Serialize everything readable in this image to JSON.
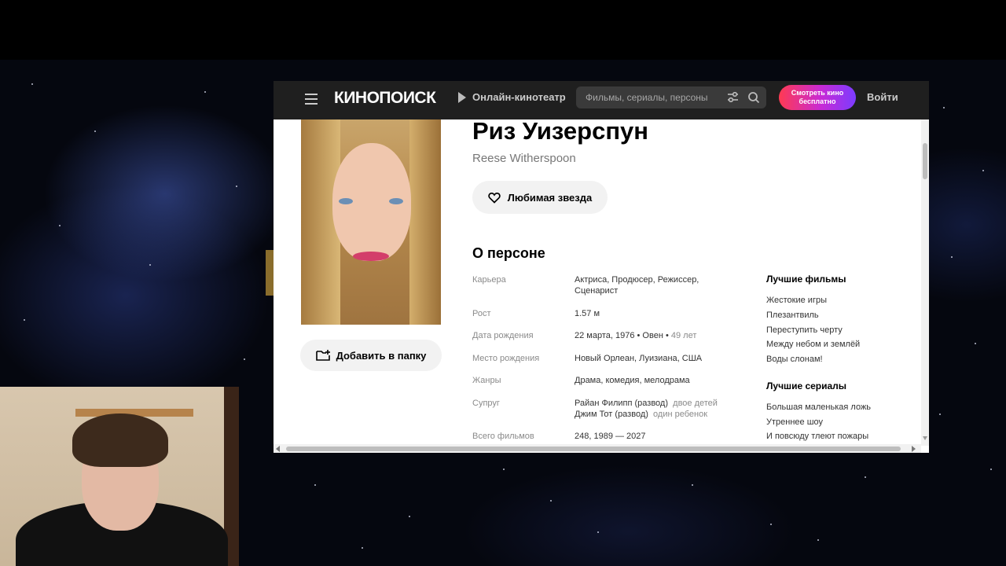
{
  "header": {
    "logo": "КИНОПОИСК",
    "online_cinema": "Онлайн-кинотеатр",
    "search_placeholder": "Фильмы, сериалы, персоны",
    "watch_free_line1": "Смотреть кино",
    "watch_free_line2": "бесплатно",
    "login": "Войти"
  },
  "person": {
    "name": "Риз Уизерспун",
    "original_name": "Reese Witherspoon",
    "favorite_button": "Любимая звезда",
    "add_to_folder_button": "Добавить в папку"
  },
  "about": {
    "title": "О персоне",
    "rows": [
      {
        "label": "Карьера",
        "value": "Актриса, Продюсер, Режиссер, Сценарист"
      },
      {
        "label": "Рост",
        "value": "1.57 м"
      },
      {
        "label": "Дата рождения",
        "value": "22 марта, 1976 • Овен • ",
        "value_extra": "49 лет"
      },
      {
        "label": "Место рождения",
        "value": "Новый Орлеан, Луизиана, США"
      },
      {
        "label": "Жанры",
        "value": "Драма, комедия, мелодрама"
      },
      {
        "label": "Супруг",
        "spouses": [
          {
            "name": "Райан Филипп (развод)",
            "note": "двое детей"
          },
          {
            "name": "Джим Тот (развод)",
            "note": "один ребенок"
          }
        ]
      },
      {
        "label": "Всего фильмов",
        "value": "248, 1989 — 2027"
      }
    ]
  },
  "best_films": {
    "title": "Лучшие фильмы",
    "items": [
      "Жестокие игры",
      "Плезантвиль",
      "Переступить черту",
      "Между небом и землёй",
      "Воды слонам!"
    ]
  },
  "best_series": {
    "title": "Лучшие сериалы",
    "items": [
      "Большая маленькая ложь",
      "Утреннее шоу",
      "И повсюду тлеют пожары"
    ]
  },
  "colors": {
    "header_bg": "#1f1f1f",
    "accent_gradient_start": "#ff3a52",
    "accent_gradient_end": "#7b3cff",
    "label_grey": "#8a8a8a"
  }
}
